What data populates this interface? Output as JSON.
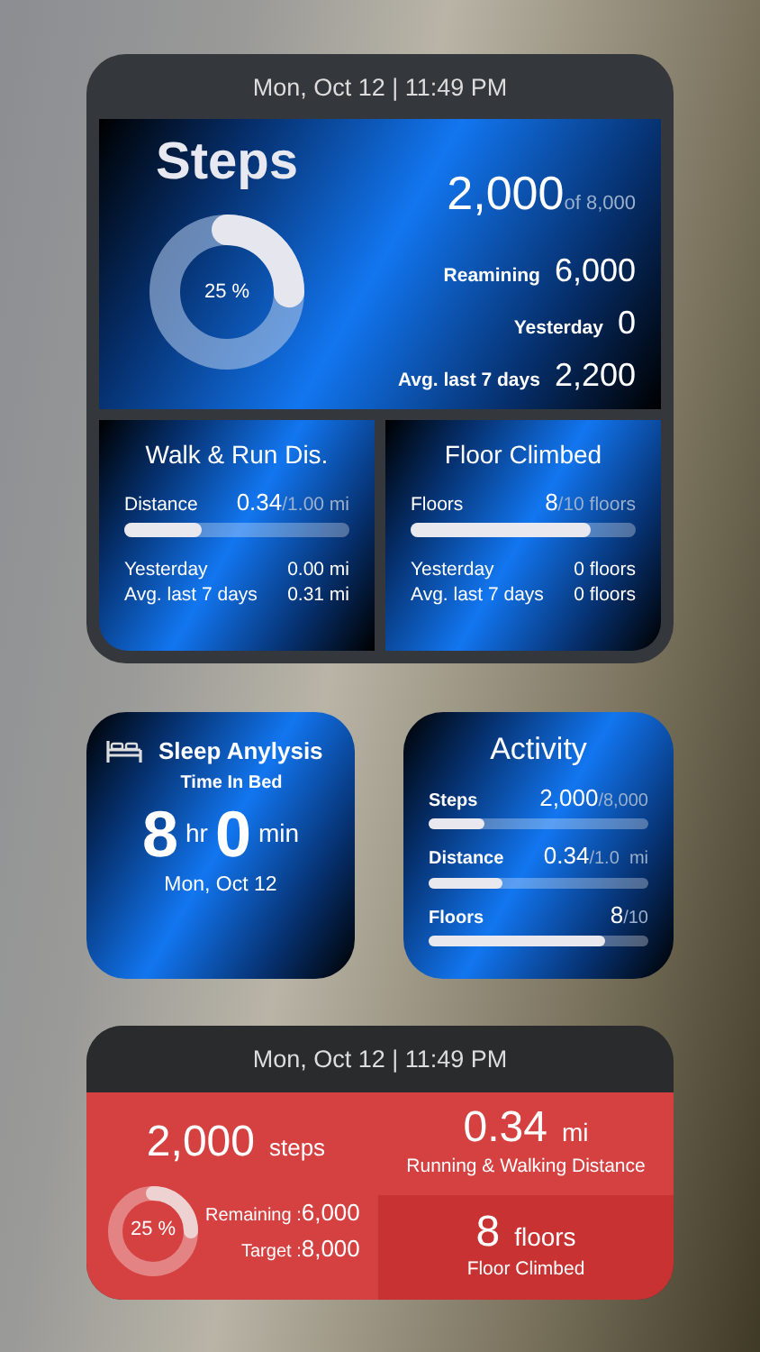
{
  "top_widget": {
    "header": "Mon, Oct 12 | 11:49 PM",
    "steps": {
      "title": "Steps",
      "ring": {
        "level": 0.25,
        "label": "25 %"
      },
      "value": "2,000",
      "of": "of 8,000",
      "stats": [
        {
          "label": "Reamining",
          "value": "6,000"
        },
        {
          "label": "Yesterday",
          "value": "0"
        },
        {
          "label": "Avg. last 7 days",
          "value": "2,200"
        }
      ]
    },
    "panels": [
      {
        "title": "Walk & Run Dis.",
        "bar_label": "Distance",
        "value": "0.34",
        "total": "/1.00 mi",
        "level": 0.34,
        "stats": [
          {
            "label": "Yesterday",
            "value": "0.00 mi"
          },
          {
            "label": "Avg. last 7 days",
            "value": "0.31 mi"
          }
        ]
      },
      {
        "title": "Floor Climbed",
        "bar_label": "Floors",
        "value": "8",
        "total": "/10 floors",
        "level": 0.8,
        "stats": [
          {
            "label": "Yesterday",
            "value": "0 floors"
          },
          {
            "label": "Avg. last 7 days",
            "value": "0 floors"
          }
        ]
      }
    ]
  },
  "sleep": {
    "title": "Sleep Anylysis",
    "subtitle": "Time In Bed",
    "hours": "8",
    "hours_unit": "hr",
    "minutes": "0",
    "minutes_unit": "min",
    "date": "Mon, Oct 12"
  },
  "activity": {
    "title": "Activity",
    "rows": [
      {
        "label": "Steps",
        "value": "2,000",
        "total": "/8,000",
        "level": 0.25
      },
      {
        "label": "Distance",
        "value": "0.34",
        "total": "/1.0  mi",
        "level": 0.34
      },
      {
        "label": "Floors",
        "value": "8",
        "total": "/10",
        "level": 0.8
      }
    ]
  },
  "bottom_widget": {
    "header": "Mon, Oct 12 | 11:49 PM",
    "steps": {
      "value": "2,000",
      "unit": "steps",
      "ring": {
        "level": 0.25,
        "label": "25 %"
      },
      "stats": [
        {
          "label": "Remaining :",
          "value": "6,000"
        },
        {
          "label": "Target :",
          "value": "8,000"
        }
      ]
    },
    "distance": {
      "value": "0.34",
      "unit": "mi",
      "caption": "Running & Walking Distance"
    },
    "floors": {
      "value": "8",
      "unit": "floors",
      "caption": "Floor Climbed"
    }
  }
}
